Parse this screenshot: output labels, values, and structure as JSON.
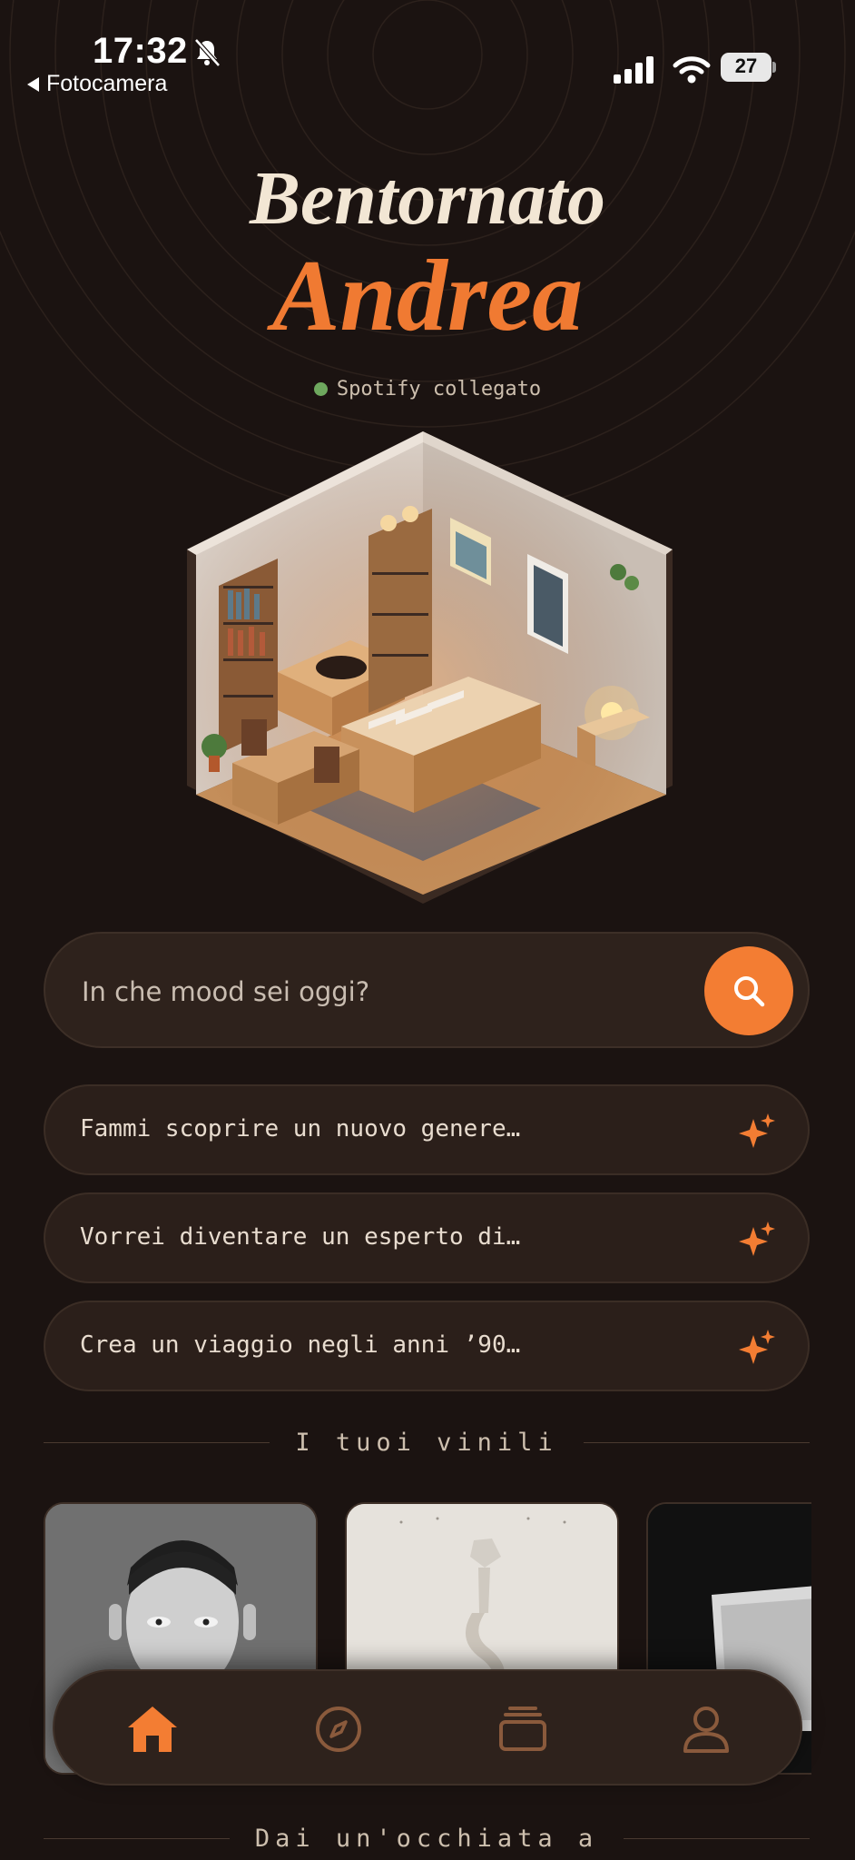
{
  "status_bar": {
    "time": "17:32",
    "back_label": "Fotocamera",
    "battery": "27"
  },
  "greeting": {
    "line1": "Bentornato",
    "name": "Andrea"
  },
  "spotify_status": "Spotify collegato",
  "search": {
    "placeholder": "In che mood sei oggi?"
  },
  "suggestions": [
    {
      "label": "Fammi scoprire un nuovo genere…",
      "icon": "sparkle-icon"
    },
    {
      "label": "Vorrei diventare un esperto di…",
      "icon": "sparkle-icon"
    },
    {
      "label": "Crea un viaggio negli anni ’90…",
      "icon": "sparkle-icon"
    }
  ],
  "sections": {
    "vinyls": "I tuoi vinili",
    "explore": "Dai un'occhiata a"
  },
  "nav": [
    {
      "name": "home",
      "icon": "home-icon",
      "active": true
    },
    {
      "name": "explore",
      "icon": "compass-icon",
      "active": false
    },
    {
      "name": "collection",
      "icon": "stack-icon",
      "active": false
    },
    {
      "name": "profile",
      "icon": "user-icon",
      "active": false
    }
  ],
  "colors": {
    "background": "#1b1311",
    "accent": "#f37d33",
    "surface": "#2e221c",
    "text": "#e8dcd0",
    "spotify_dot": "#6ea85e"
  }
}
